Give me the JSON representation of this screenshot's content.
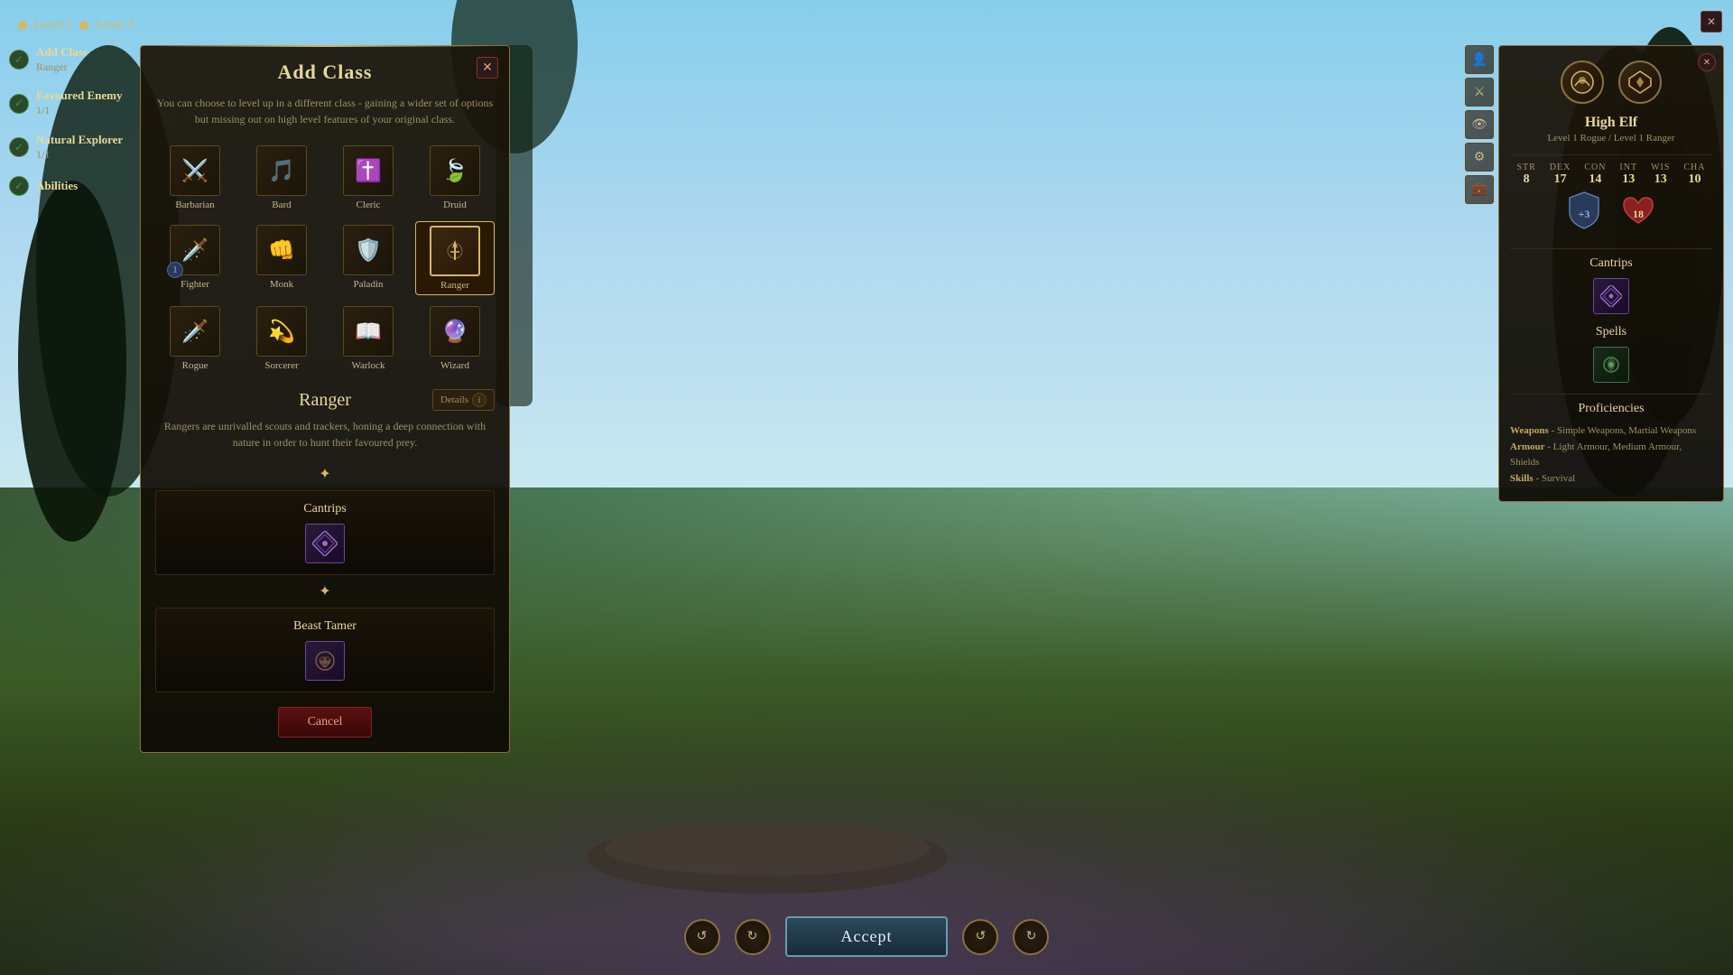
{
  "topbar": {
    "level1": "Level 1",
    "level2": "Level 2"
  },
  "left_sidebar": {
    "items": [
      {
        "label": "Add Class",
        "sublabel": "Ranger",
        "checked": true
      },
      {
        "label": "Favoured Enemy",
        "sublabel": "1/1",
        "checked": true
      },
      {
        "label": "Natural Explorer",
        "sublabel": "1/1",
        "checked": true
      },
      {
        "label": "Abilities",
        "sublabel": "",
        "checked": true
      }
    ]
  },
  "add_class_panel": {
    "title": "Add Class",
    "description": "You can choose to level up in a different class - gaining a wider set of options but missing out on high level features of your original class.",
    "classes": [
      {
        "name": "Barbarian",
        "icon": "⚔",
        "selected": false
      },
      {
        "name": "Bard",
        "icon": "🎵",
        "selected": false
      },
      {
        "name": "Cleric",
        "icon": "✝",
        "selected": false
      },
      {
        "name": "Druid",
        "icon": "🌿",
        "selected": false
      },
      {
        "name": "Fighter",
        "icon": "🗡",
        "selected": false,
        "badge": "1"
      },
      {
        "name": "Monk",
        "icon": "👊",
        "selected": false
      },
      {
        "name": "Paladin",
        "icon": "🛡",
        "selected": false
      },
      {
        "name": "Ranger",
        "icon": "🏹",
        "selected": true
      },
      {
        "name": "Rogue",
        "icon": "🗡",
        "selected": false
      },
      {
        "name": "Sorcerer",
        "icon": "💫",
        "selected": false
      },
      {
        "name": "Warlock",
        "icon": "📖",
        "selected": false
      },
      {
        "name": "Wizard",
        "icon": "🔮",
        "selected": false
      }
    ],
    "selected_class": {
      "name": "Ranger",
      "description": "Rangers are unrivalled scouts and trackers, honing a deep connection with nature in order to hunt their favoured prey.",
      "details_label": "Details"
    },
    "cantrips_section": {
      "title": "Cantrips",
      "icon": "✦"
    },
    "beast_tamer_section": {
      "title": "Beast Tamer",
      "icon": "🐾"
    },
    "cancel_label": "Cancel"
  },
  "right_panel": {
    "race_name": "High Elf",
    "race_level": "Level 1 Rogue / Level 1 Ranger",
    "stats": [
      {
        "label": "STR",
        "value": "8"
      },
      {
        "label": "DEX",
        "value": "17"
      },
      {
        "label": "CON",
        "value": "14"
      },
      {
        "label": "INT",
        "value": "13"
      },
      {
        "label": "WIS",
        "value": "13"
      },
      {
        "label": "CHA",
        "value": "10"
      }
    ],
    "armor_class": "+3",
    "hp": "18",
    "cantrips_title": "Cantrips",
    "cantrips_icon": "✦",
    "spells_title": "Spells",
    "spells_icon": "🌿",
    "proficiencies_title": "Proficiencies",
    "proficiencies": [
      {
        "label": "Weapons",
        "value": "Simple Weapons, Martial Weapons"
      },
      {
        "label": "Armour",
        "value": "Light Armour, Medium Armour, Shields"
      },
      {
        "label": "Skills",
        "value": "Survival"
      }
    ]
  },
  "bottom_bar": {
    "accept_label": "Accept"
  }
}
